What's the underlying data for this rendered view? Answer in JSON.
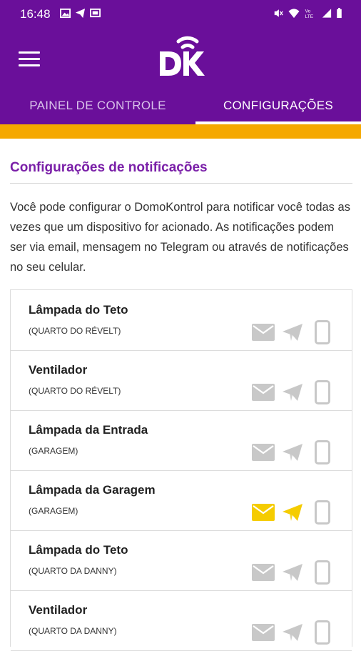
{
  "status_bar": {
    "time": "16:48"
  },
  "app_bar": {
    "tabs": [
      {
        "label": "PAINEL DE CONTROLE",
        "active": false
      },
      {
        "label": "CONFIGURAÇÕES",
        "active": true
      }
    ]
  },
  "colors": {
    "primary": "#6a0f9a",
    "accent_orange": "#f5a800",
    "title_purple": "#7a1fa8",
    "icon_inactive": "#c8c8c8",
    "icon_active": "#f5cc00"
  },
  "section": {
    "title": "Configurações de notificações",
    "description": "Você pode configurar o DomoKontrol para notificar você todas as vezes que um dispositivo for acionado. As notificações podem ser via email, mensagem no Telegram ou através de notificações no seu celular."
  },
  "devices": [
    {
      "name": "Lâmpada do Teto",
      "room": "(QUARTO DO RÉVELT)",
      "email": false,
      "telegram": false,
      "phone": false
    },
    {
      "name": "Ventilador",
      "room": "(QUARTO DO RÉVELT)",
      "email": false,
      "telegram": false,
      "phone": false
    },
    {
      "name": "Lâmpada da Entrada",
      "room": "(GARAGEM)",
      "email": false,
      "telegram": false,
      "phone": false
    },
    {
      "name": "Lâmpada da Garagem",
      "room": "(GARAGEM)",
      "email": true,
      "telegram": true,
      "phone": false
    },
    {
      "name": "Lâmpada do Teto",
      "room": "(QUARTO DA DANNY)",
      "email": false,
      "telegram": false,
      "phone": false
    },
    {
      "name": "Ventilador",
      "room": "(QUARTO DA DANNY)",
      "email": false,
      "telegram": false,
      "phone": false
    }
  ]
}
